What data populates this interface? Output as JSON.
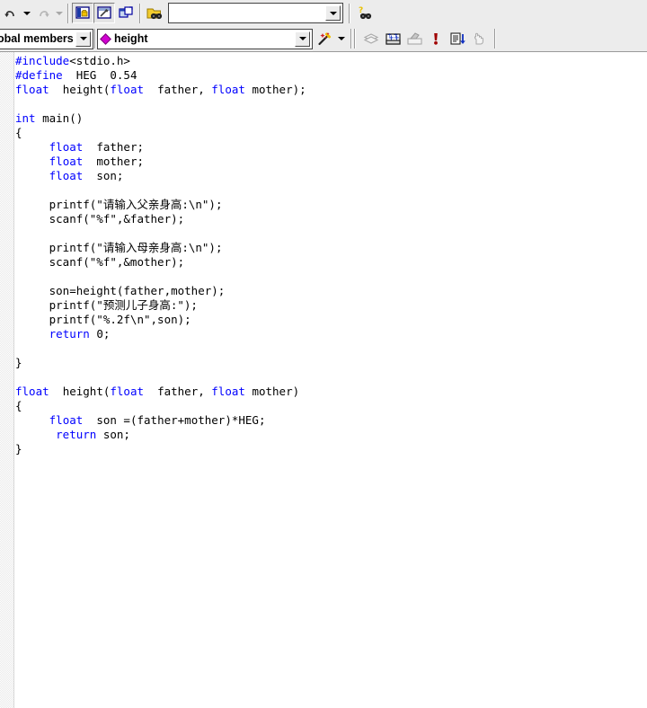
{
  "window": {
    "title": "Microsoft Visual C++ - Source Editor",
    "accent_color": "#0000ff",
    "toolbar_bg": "#ececec",
    "editor_bg": "#ffffff"
  },
  "toolbar_standard": {
    "buttons": [
      {
        "name": "undo-button",
        "icon": "undo-icon",
        "tooltip": "Undo",
        "enabled": true
      },
      {
        "name": "undo-dropdown",
        "icon": "chevron-down-icon",
        "tooltip": "Undo history",
        "enabled": true
      },
      {
        "name": "redo-button",
        "icon": "redo-icon",
        "tooltip": "Redo",
        "enabled": false
      },
      {
        "name": "redo-dropdown",
        "icon": "chevron-down-icon",
        "tooltip": "Redo history",
        "enabled": false
      },
      {
        "name": "workspace-button",
        "icon": "workspace-window-icon",
        "tooltip": "Workspace",
        "enabled": true,
        "pressed": true
      },
      {
        "name": "output-button",
        "icon": "build-output-icon",
        "tooltip": "Output",
        "enabled": true,
        "pressed": true
      },
      {
        "name": "window-list-button",
        "icon": "window-list-icon",
        "tooltip": "Window list",
        "enabled": true,
        "pressed": false
      },
      {
        "name": "find-in-files-button",
        "icon": "find-in-files-icon",
        "tooltip": "Find in Files",
        "enabled": true
      },
      {
        "name": "search-help-button",
        "icon": "search-help-icon",
        "tooltip": "Search",
        "enabled": true
      }
    ],
    "find_combo": {
      "value": "",
      "placeholder": ""
    }
  },
  "toolbar_wizardbar": {
    "scope_combo": {
      "value": "obal members",
      "full_value": "Global members"
    },
    "member_combo": {
      "value": "height",
      "icon": "member-diamond-icon",
      "icon_color": "#d000d0"
    },
    "wizard_button": {
      "name": "wizard-button",
      "icon": "magic-wand-icon",
      "tooltip": "WizardBar actions"
    },
    "wizard_dropdown": {
      "name": "wizard-dropdown",
      "icon": "chevron-down-icon"
    },
    "debug_buttons": [
      {
        "name": "layers-button",
        "icon": "layers-icon",
        "tooltip": "Display layers",
        "enabled": false
      },
      {
        "name": "insert-breakpoint-button",
        "icon": "breakpoint-insert-icon",
        "tooltip": "Insert/Remove Breakpoint",
        "enabled": true
      },
      {
        "name": "disable-breakpoint-button",
        "icon": "breakpoint-disable-icon",
        "tooltip": "Disable Breakpoint",
        "enabled": false
      },
      {
        "name": "error-marker-button",
        "icon": "exclamation-icon",
        "tooltip": "Errors",
        "enabled": true
      },
      {
        "name": "go-to-definition-button",
        "icon": "document-down-arrow-icon",
        "tooltip": "Go to next item",
        "enabled": true
      },
      {
        "name": "pan-button",
        "icon": "hand-icon",
        "tooltip": "Pan",
        "enabled": false
      }
    ]
  },
  "editor": {
    "language": "C",
    "filename": "",
    "lines": [
      {
        "indent": 0,
        "tokens": [
          {
            "t": "#include",
            "c": "kw"
          },
          {
            "t": "<stdio.h>",
            "c": ""
          }
        ]
      },
      {
        "indent": 0,
        "tokens": [
          {
            "t": "#define",
            "c": "kw"
          },
          {
            "t": "  HEG  0.54",
            "c": ""
          }
        ]
      },
      {
        "indent": 0,
        "tokens": [
          {
            "t": "float",
            "c": "kw"
          },
          {
            "t": "  height(",
            "c": ""
          },
          {
            "t": "float",
            "c": "kw"
          },
          {
            "t": "  father, ",
            "c": ""
          },
          {
            "t": "float",
            "c": "kw"
          },
          {
            "t": " mother);",
            "c": ""
          }
        ]
      },
      {
        "indent": 0,
        "tokens": []
      },
      {
        "indent": 0,
        "tokens": [
          {
            "t": "int",
            "c": "kw"
          },
          {
            "t": " main()",
            "c": ""
          }
        ]
      },
      {
        "indent": 0,
        "tokens": [
          {
            "t": "{",
            "c": ""
          }
        ]
      },
      {
        "indent": 0,
        "tokens": [
          {
            "t": "     ",
            "c": ""
          },
          {
            "t": "float",
            "c": "kw"
          },
          {
            "t": "  father;",
            "c": ""
          }
        ]
      },
      {
        "indent": 0,
        "tokens": [
          {
            "t": "     ",
            "c": ""
          },
          {
            "t": "float",
            "c": "kw"
          },
          {
            "t": "  mother;",
            "c": ""
          }
        ]
      },
      {
        "indent": 0,
        "tokens": [
          {
            "t": "     ",
            "c": ""
          },
          {
            "t": "float",
            "c": "kw"
          },
          {
            "t": "  son;",
            "c": ""
          }
        ]
      },
      {
        "indent": 0,
        "tokens": []
      },
      {
        "indent": 0,
        "tokens": [
          {
            "t": "     printf(\"请输入父亲身高:\\n\");",
            "c": ""
          }
        ]
      },
      {
        "indent": 0,
        "tokens": [
          {
            "t": "     scanf(\"%f\",&father);",
            "c": ""
          }
        ]
      },
      {
        "indent": 0,
        "tokens": []
      },
      {
        "indent": 0,
        "tokens": [
          {
            "t": "     printf(\"请输入母亲身高:\\n\");",
            "c": ""
          }
        ]
      },
      {
        "indent": 0,
        "tokens": [
          {
            "t": "     scanf(\"%f\",&mother);",
            "c": ""
          }
        ]
      },
      {
        "indent": 0,
        "tokens": []
      },
      {
        "indent": 0,
        "tokens": [
          {
            "t": "     son=height(father,mother);",
            "c": ""
          }
        ]
      },
      {
        "indent": 0,
        "tokens": [
          {
            "t": "     printf(\"预测儿子身高:\");",
            "c": ""
          }
        ]
      },
      {
        "indent": 0,
        "tokens": [
          {
            "t": "     printf(\"%.2f\\n\",son);",
            "c": ""
          }
        ]
      },
      {
        "indent": 0,
        "tokens": [
          {
            "t": "     ",
            "c": ""
          },
          {
            "t": "return",
            "c": "kw"
          },
          {
            "t": " 0;",
            "c": ""
          }
        ]
      },
      {
        "indent": 0,
        "tokens": []
      },
      {
        "indent": 0,
        "tokens": [
          {
            "t": "}",
            "c": ""
          }
        ]
      },
      {
        "indent": 0,
        "tokens": []
      },
      {
        "indent": 0,
        "tokens": [
          {
            "t": "float",
            "c": "kw"
          },
          {
            "t": "  height(",
            "c": ""
          },
          {
            "t": "float",
            "c": "kw"
          },
          {
            "t": "  father, ",
            "c": ""
          },
          {
            "t": "float",
            "c": "kw"
          },
          {
            "t": " mother)",
            "c": ""
          }
        ]
      },
      {
        "indent": 0,
        "tokens": [
          {
            "t": "{",
            "c": ""
          }
        ]
      },
      {
        "indent": 0,
        "tokens": [
          {
            "t": "     ",
            "c": ""
          },
          {
            "t": "float",
            "c": "kw"
          },
          {
            "t": "  son =(father+mother)*HEG;",
            "c": ""
          }
        ]
      },
      {
        "indent": 0,
        "tokens": [
          {
            "t": "      ",
            "c": ""
          },
          {
            "t": "return",
            "c": "kw"
          },
          {
            "t": " son;",
            "c": ""
          }
        ]
      },
      {
        "indent": 0,
        "tokens": [
          {
            "t": "}",
            "c": ""
          }
        ]
      }
    ]
  }
}
